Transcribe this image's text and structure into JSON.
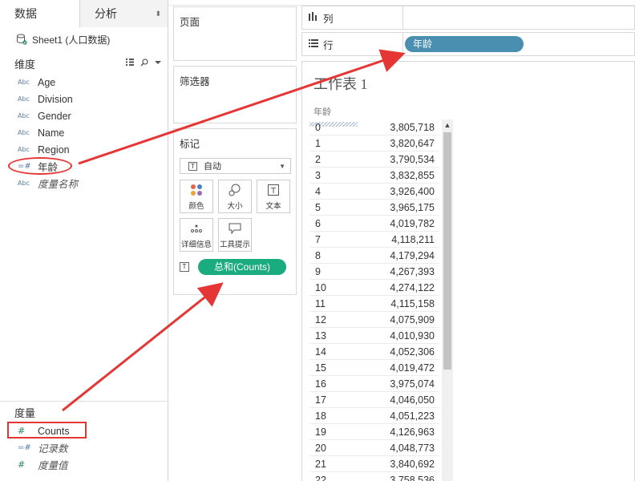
{
  "tabs": {
    "data": "数据",
    "analysis": "分析",
    "sort_glyph": "⬍"
  },
  "datasource": "Sheet1 (人口数据)",
  "dimensions": {
    "title": "维度",
    "fields": [
      {
        "type": "Abc",
        "name": "Age"
      },
      {
        "type": "Abc",
        "name": "Division"
      },
      {
        "type": "Abc",
        "name": "Gender"
      },
      {
        "type": "Abc",
        "name": "Name"
      },
      {
        "type": "Abc",
        "name": "Region"
      },
      {
        "type": "=#",
        "name": "年龄"
      },
      {
        "type": "Abc",
        "name": "度量名称"
      }
    ]
  },
  "measures": {
    "title": "度量",
    "fields": [
      {
        "type": "#",
        "name": "Counts"
      },
      {
        "type": "=#",
        "name": "记录数"
      },
      {
        "type": "#",
        "name": "度量值"
      }
    ]
  },
  "cards": {
    "pages": "页面",
    "filters": "筛选器",
    "marks": "标记",
    "mark_type": "自动",
    "mark_buttons": {
      "color": "颜色",
      "size": "大小",
      "text": "文本",
      "detail": "详细信息",
      "tooltip": "工具提示"
    },
    "text_pill": "总和(Counts)"
  },
  "shelves": {
    "columns": "列",
    "rows": "行",
    "row_pill": "年龄"
  },
  "sheet": {
    "title": "工作表 1",
    "column_header": "年龄",
    "rows": [
      {
        "k": "0",
        "v": "3,805,718"
      },
      {
        "k": "1",
        "v": "3,820,647"
      },
      {
        "k": "2",
        "v": "3,790,534"
      },
      {
        "k": "3",
        "v": "3,832,855"
      },
      {
        "k": "4",
        "v": "3,926,400"
      },
      {
        "k": "5",
        "v": "3,965,175"
      },
      {
        "k": "6",
        "v": "4,019,782"
      },
      {
        "k": "7",
        "v": "4,118,211"
      },
      {
        "k": "8",
        "v": "4,179,294"
      },
      {
        "k": "9",
        "v": "4,267,393"
      },
      {
        "k": "10",
        "v": "4,274,122"
      },
      {
        "k": "11",
        "v": "4,115,158"
      },
      {
        "k": "12",
        "v": "4,075,909"
      },
      {
        "k": "13",
        "v": "4,010,930"
      },
      {
        "k": "14",
        "v": "4,052,306"
      },
      {
        "k": "15",
        "v": "4,019,472"
      },
      {
        "k": "16",
        "v": "3,975,074"
      },
      {
        "k": "17",
        "v": "4,046,050"
      },
      {
        "k": "18",
        "v": "4,051,223"
      },
      {
        "k": "19",
        "v": "4,126,963"
      },
      {
        "k": "20",
        "v": "4,048,773"
      },
      {
        "k": "21",
        "v": "3,840,692"
      },
      {
        "k": "22",
        "v": "3,758,536"
      }
    ]
  },
  "colors": {
    "row_pill": "#4a8fb0",
    "text_pill": "#1aab7e",
    "annotation": "#e63535"
  }
}
